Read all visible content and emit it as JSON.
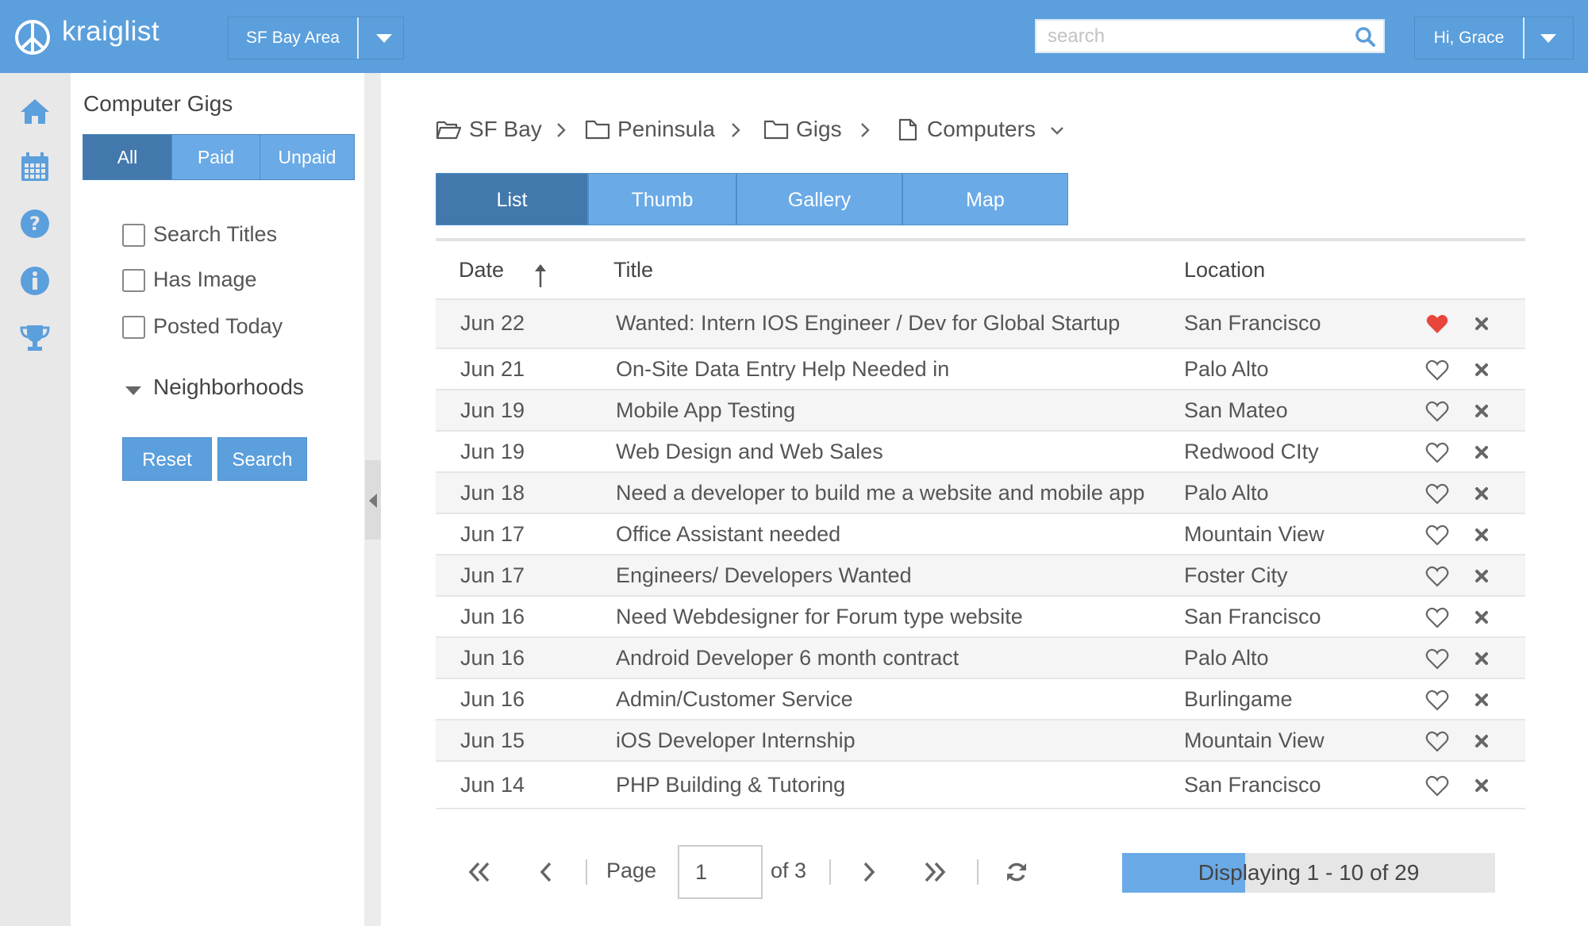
{
  "app": {
    "name": "kraiglist",
    "region": "SF Bay Area",
    "search_placeholder": "search",
    "user_greeting": "Hi, Grace"
  },
  "rail": {
    "icons": [
      "home-icon",
      "calendar-icon",
      "help-icon",
      "info-icon",
      "trophy-icon"
    ]
  },
  "filters": {
    "title": "Computer Gigs",
    "segments": [
      "All",
      "Paid",
      "Unpaid"
    ],
    "active_segment": "All",
    "checkboxes": [
      {
        "label": "Search Titles",
        "checked": false
      },
      {
        "label": "Has Image",
        "checked": false
      },
      {
        "label": "Posted Today",
        "checked": false
      }
    ],
    "neighborhoods_label": "Neighborhoods",
    "reset_label": "Reset",
    "search_label": "Search"
  },
  "breadcrumb": [
    {
      "label": "SF Bay",
      "icon": "folder-open-icon"
    },
    {
      "label": "Peninsula",
      "icon": "folder-icon"
    },
    {
      "label": "Gigs",
      "icon": "folder-icon"
    },
    {
      "label": "Computers",
      "icon": "file-icon"
    }
  ],
  "view_tabs": {
    "tabs": [
      "List",
      "Thumb",
      "Gallery",
      "Map"
    ],
    "active": "List"
  },
  "table": {
    "columns": [
      "Date",
      "Title",
      "Location"
    ],
    "sort_column": "Date",
    "rows": [
      {
        "date": "Jun 22",
        "title": "Wanted: Intern IOS Engineer / Dev for Global Startup",
        "location": "San Francisco",
        "favorited": true
      },
      {
        "date": "Jun 21",
        "title": "On-Site Data Entry Help Needed in",
        "location": "Palo Alto",
        "favorited": false
      },
      {
        "date": "Jun 19",
        "title": "Mobile App Testing",
        "location": "San Mateo",
        "favorited": false
      },
      {
        "date": "Jun 19",
        "title": "Web Design and Web Sales",
        "location": "Redwood CIty",
        "favorited": false
      },
      {
        "date": "Jun 18",
        "title": "Need a developer to build me a website and mobile app",
        "location": "Palo Alto",
        "favorited": false
      },
      {
        "date": "Jun 17",
        "title": "Office Assistant needed",
        "location": "Mountain View",
        "favorited": false
      },
      {
        "date": "Jun 17",
        "title": "Engineers/ Developers Wanted",
        "location": "Foster City",
        "favorited": false
      },
      {
        "date": "Jun 16",
        "title": "Need Webdesigner for Forum type website",
        "location": "San Francisco",
        "favorited": false
      },
      {
        "date": "Jun 16",
        "title": "Android Developer 6 month contract",
        "location": "Palo Alto",
        "favorited": false
      },
      {
        "date": "Jun 16",
        "title": "Admin/Customer Service",
        "location": "Burlingame",
        "favorited": false
      },
      {
        "date": "Jun 15",
        "title": "iOS Developer Internship",
        "location": "Mountain View",
        "favorited": false
      },
      {
        "date": "Jun 14",
        "title": "PHP Building & Tutoring",
        "location": "San Francisco",
        "favorited": false
      }
    ]
  },
  "pager": {
    "page_label": "Page",
    "current_page": "1",
    "of_label": "of 3",
    "display_text": "Displaying 1 - 10 of 29",
    "progress_fraction": 0.33
  },
  "colors": {
    "brand": "#5b9fdc",
    "active": "#4378ad",
    "favorite": "#e8453c"
  }
}
